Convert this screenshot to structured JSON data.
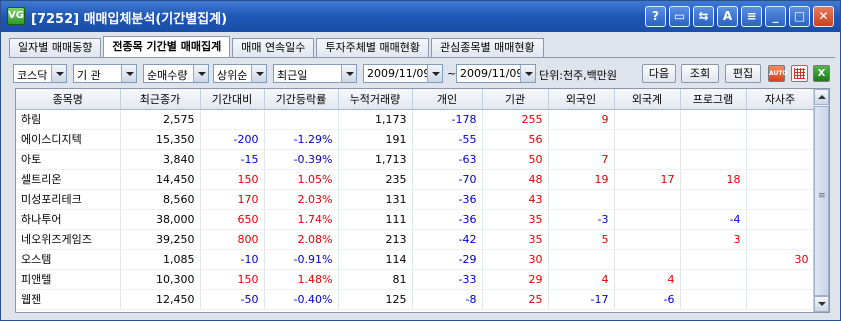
{
  "window": {
    "app_icon": "VG",
    "title": "[7252] 매매입체분석(기간별집계)",
    "buttons": [
      {
        "name": "help-button",
        "glyph": "?"
      },
      {
        "name": "restore-small-button",
        "glyph": "▭"
      },
      {
        "name": "link-button",
        "glyph": "⇆"
      },
      {
        "name": "font-button",
        "glyph": "A"
      },
      {
        "name": "menu-button",
        "glyph": "≡"
      },
      {
        "name": "minimize-button",
        "glyph": "_"
      },
      {
        "name": "maximize-button",
        "glyph": "□"
      },
      {
        "name": "close-button",
        "glyph": "✕"
      }
    ]
  },
  "tabs": [
    {
      "label": "일자별 매매동향",
      "active": false
    },
    {
      "label": "전종목 기간별 매매집계",
      "active": true
    },
    {
      "label": "매매 연속일수",
      "active": false
    },
    {
      "label": "투자주체별 매매현황",
      "active": false
    },
    {
      "label": "관심종목별 매매현황",
      "active": false
    }
  ],
  "toolbar": {
    "market": "코스닥",
    "investor": "기 관",
    "sort_by": "순매수량",
    "order": "상위순",
    "period": "최근일",
    "date_from": "2009/11/09",
    "tilde": "~",
    "date_to": "2009/11/09",
    "unit": "단위:천주,백만원",
    "next_label": "다음",
    "query_label": "조회",
    "edit_label": "편집",
    "auto_label": "AUTO",
    "excel_label": "X"
  },
  "table": {
    "columns": [
      "종목명",
      "최근종가",
      "기간대비",
      "기간등락률",
      "누적거래량",
      "개인",
      "기관",
      "외국인",
      "외국계",
      "프로그램",
      "자사주"
    ],
    "rows": [
      {
        "name": "하림",
        "close": "2,575",
        "chg": "",
        "chg_dir": "",
        "rate": "",
        "volume": "1,173",
        "indiv": "-178",
        "inst": "255",
        "foreign": "9",
        "foreign_co": "",
        "program": "",
        "treasury": ""
      },
      {
        "name": "에이스디지텍",
        "close": "15,350",
        "chg": "-200",
        "chg_dir": "down",
        "rate": "-1.29%",
        "volume": "191",
        "indiv": "-55",
        "inst": "56",
        "foreign": "",
        "foreign_co": "",
        "program": "",
        "treasury": ""
      },
      {
        "name": "아토",
        "close": "3,840",
        "chg": "-15",
        "chg_dir": "down",
        "rate": "-0.39%",
        "volume": "1,713",
        "indiv": "-63",
        "inst": "50",
        "foreign": "7",
        "foreign_co": "",
        "program": "",
        "treasury": ""
      },
      {
        "name": "셀트리온",
        "close": "14,450",
        "chg": "150",
        "chg_dir": "up",
        "rate": "1.05%",
        "volume": "235",
        "indiv": "-70",
        "inst": "48",
        "foreign": "19",
        "foreign_co": "17",
        "program": "18",
        "treasury": ""
      },
      {
        "name": "미성포리테크",
        "close": "8,560",
        "chg": "170",
        "chg_dir": "up",
        "rate": "2.03%",
        "volume": "131",
        "indiv": "-36",
        "inst": "43",
        "foreign": "",
        "foreign_co": "",
        "program": "",
        "treasury": ""
      },
      {
        "name": "하나투어",
        "close": "38,000",
        "chg": "650",
        "chg_dir": "up",
        "rate": "1.74%",
        "volume": "111",
        "indiv": "-36",
        "inst": "35",
        "foreign": "-3",
        "foreign_co": "",
        "program": "-4",
        "treasury": ""
      },
      {
        "name": "네오위즈게임즈",
        "close": "39,250",
        "chg": "800",
        "chg_dir": "up",
        "rate": "2.08%",
        "volume": "213",
        "indiv": "-42",
        "inst": "35",
        "foreign": "5",
        "foreign_co": "",
        "program": "3",
        "treasury": ""
      },
      {
        "name": "오스템",
        "close": "1,085",
        "chg": "-10",
        "chg_dir": "down",
        "rate": "-0.91%",
        "volume": "114",
        "indiv": "-29",
        "inst": "30",
        "foreign": "",
        "foreign_co": "",
        "program": "",
        "treasury": "30"
      },
      {
        "name": "피앤텔",
        "close": "10,300",
        "chg": "150",
        "chg_dir": "up",
        "rate": "1.48%",
        "volume": "81",
        "indiv": "-33",
        "inst": "29",
        "foreign": "4",
        "foreign_co": "4",
        "program": "",
        "treasury": ""
      },
      {
        "name": "웹젠",
        "close": "12,450",
        "chg": "-50",
        "chg_dir": "down",
        "rate": "-0.40%",
        "volume": "125",
        "indiv": "-8",
        "inst": "25",
        "foreign": "-17",
        "foreign_co": "-6",
        "program": "",
        "treasury": ""
      }
    ]
  },
  "colors": {
    "up": "#e00000",
    "down": "#0000d0",
    "titlebar": "#1f57b5"
  }
}
